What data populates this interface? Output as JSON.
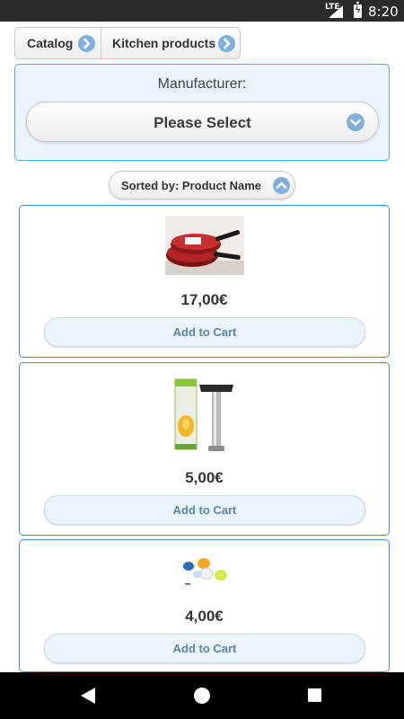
{
  "status_bar": {
    "network": "LTE",
    "time": "8:20"
  },
  "breadcrumb": {
    "items": [
      "Catalog",
      "Kitchen products"
    ]
  },
  "filter": {
    "label": "Manufacturer:",
    "selected": "Please Select"
  },
  "sort": {
    "label": "Sorted by: Product Name"
  },
  "products": [
    {
      "price": "17,00€",
      "button": "Add to Cart",
      "image": "red-frying-pans"
    },
    {
      "price": "5,00€",
      "button": "Add to Cart",
      "image": "pineapple-slicer"
    },
    {
      "price": "4,00€",
      "button": "Add to Cart",
      "image": "colorful-bag-clips"
    }
  ],
  "icons": {
    "accent": "#7fb0dc",
    "border": "#3a8fd0",
    "button_text": "#5a86b0"
  }
}
